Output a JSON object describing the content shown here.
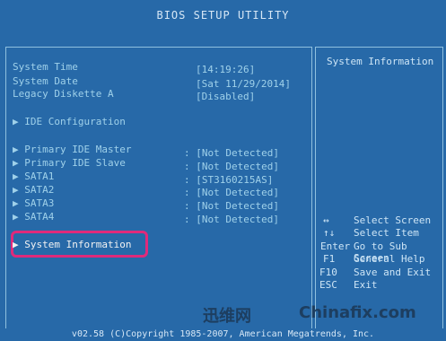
{
  "title": "BIOS SETUP UTILITY",
  "fields": [
    {
      "label": "System Time",
      "value": "[14:19:26]"
    },
    {
      "label": "System Date",
      "value": "[Sat 11/29/2014]"
    },
    {
      "label": "Legacy Diskette A",
      "value": "[Disabled]"
    }
  ],
  "ide_config": "▶ IDE Configuration",
  "devices": [
    {
      "label": "▶ Primary IDE Master",
      "value": ": [Not Detected]"
    },
    {
      "label": "▶ Primary IDE Slave",
      "value": ": [Not Detected]"
    },
    {
      "label": "▶ SATA1",
      "value": ": [ST3160215AS]"
    },
    {
      "label": "▶ SATA2",
      "value": ": [Not Detected]"
    },
    {
      "label": "▶ SATA3",
      "value": ": [Not Detected]"
    },
    {
      "label": "▶ SATA4",
      "value": ": [Not Detected]"
    }
  ],
  "system_info_item": "▶ System Information",
  "help_title": "System Information",
  "keys": [
    {
      "key": "↔",
      "action": "Select Screen"
    },
    {
      "key": "↑↓",
      "action": "Select Item"
    },
    {
      "key": "Enter",
      "action": "Go to Sub Screen"
    },
    {
      "key": "F1",
      "action": "General Help"
    },
    {
      "key": "F10",
      "action": "Save and Exit"
    },
    {
      "key": "ESC",
      "action": "Exit"
    }
  ],
  "footer": "v02.58 (C)Copyright 1985-2007, American Megatrends, Inc.",
  "watermark_left": "迅维网",
  "watermark_right": "Chinafix.com"
}
